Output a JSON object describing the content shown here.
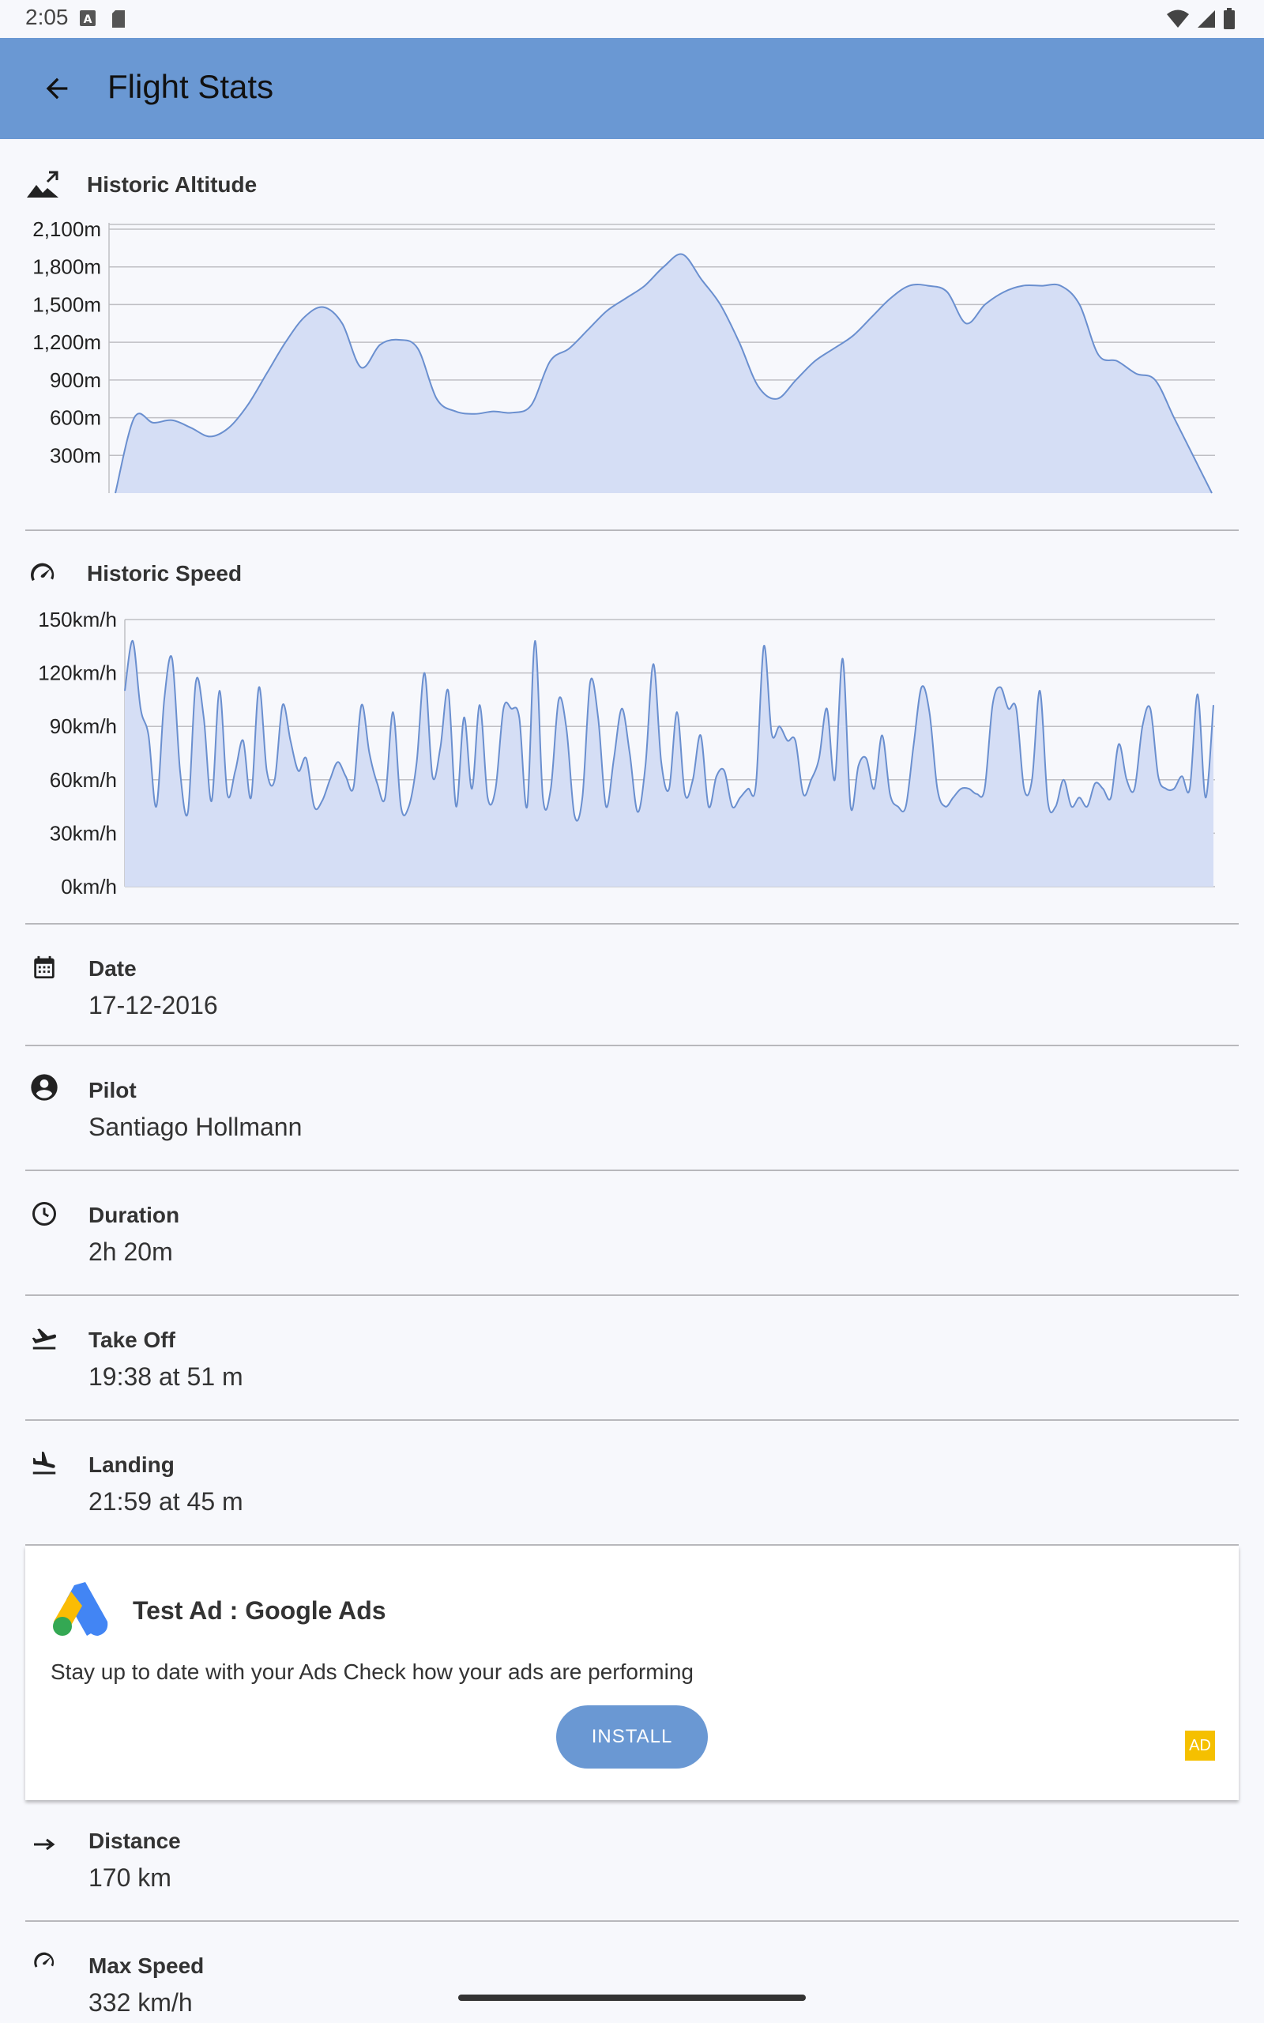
{
  "status_bar": {
    "time": "2:05",
    "icons": [
      "a-icon",
      "sd-card-icon",
      "wifi-icon",
      "signal-icon",
      "battery-icon"
    ]
  },
  "app_bar": {
    "title": "Flight Stats",
    "back_icon": "arrow-back-icon"
  },
  "altitude_section": {
    "title": "Historic Altitude",
    "icon": "terrain-up-icon",
    "chart_data": {
      "type": "area",
      "ylabels": [
        "2,100m",
        "1,800m",
        "1,500m",
        "1,200m",
        "900m",
        "600m",
        "300m"
      ],
      "ylim": [
        0,
        2100
      ],
      "y_unit": "m",
      "grid": true,
      "values": [
        0,
        600,
        560,
        580,
        520,
        450,
        520,
        700,
        950,
        1200,
        1400,
        1480,
        1350,
        1000,
        1180,
        1220,
        1150,
        750,
        650,
        630,
        650,
        640,
        700,
        1050,
        1150,
        1300,
        1450,
        1550,
        1650,
        1800,
        1900,
        1700,
        1500,
        1200,
        850,
        750,
        900,
        1050,
        1150,
        1250,
        1400,
        1550,
        1650,
        1650,
        1600,
        1350,
        1500,
        1600,
        1650,
        1650,
        1650,
        1500,
        1100,
        1050,
        950,
        900,
        600,
        300,
        0
      ]
    }
  },
  "speed_section": {
    "title": "Historic Speed",
    "icon": "speedometer-icon",
    "chart_data": {
      "type": "area",
      "ylabels": [
        "150km/h",
        "120km/h",
        "90km/h",
        "60km/h",
        "30km/h",
        "0km/h"
      ],
      "ylim": [
        0,
        150
      ],
      "y_unit": "km/h",
      "grid": true,
      "values": [
        110,
        138,
        100,
        85,
        45,
        105,
        128,
        65,
        42,
        115,
        95,
        48,
        110,
        52,
        65,
        82,
        50,
        112,
        65,
        60,
        102,
        82,
        65,
        72,
        45,
        48,
        60,
        70,
        62,
        56,
        102,
        75,
        58,
        50,
        98,
        45,
        45,
        70,
        120,
        62,
        78,
        110,
        45,
        95,
        55,
        102,
        50,
        55,
        100,
        100,
        95,
        45,
        138,
        50,
        55,
        105,
        88,
        40,
        50,
        115,
        95,
        45,
        72,
        100,
        75,
        42,
        68,
        125,
        70,
        55,
        98,
        52,
        60,
        85,
        45,
        62,
        65,
        45,
        50,
        55,
        57,
        135,
        86,
        90,
        82,
        82,
        52,
        60,
        72,
        100,
        60,
        128,
        45,
        68,
        72,
        55,
        85,
        52,
        45,
        45,
        80,
        112,
        98,
        55,
        45,
        50,
        55,
        55,
        52,
        55,
        102,
        112,
        100,
        100,
        55,
        60,
        110,
        48,
        45,
        60,
        45,
        50,
        45,
        58,
        55,
        50,
        80,
        60,
        55,
        90,
        100,
        62,
        55,
        55,
        62,
        55,
        108,
        50,
        102
      ]
    }
  },
  "details": [
    {
      "icon": "calendar-icon",
      "label": "Date",
      "value": "17-12-2016"
    },
    {
      "icon": "account-circle-icon",
      "label": "Pilot",
      "value": "Santiago Hollmann"
    },
    {
      "icon": "clock-icon",
      "label": "Duration",
      "value": "2h 20m"
    },
    {
      "icon": "flight-takeoff-icon",
      "label": "Take Off",
      "value": "19:38 at 51 m"
    },
    {
      "icon": "flight-land-icon",
      "label": "Landing",
      "value": "21:59 at 45 m"
    }
  ],
  "ad": {
    "title": "Test Ad : Google Ads",
    "body": "Stay up to date with your Ads Check how your ads are performing",
    "button": "INSTALL",
    "badge": "AD",
    "logo_icon": "google-ads-logo-icon"
  },
  "more_details": [
    {
      "icon": "arrow-right-icon",
      "label": "Distance",
      "value": "170 km"
    },
    {
      "icon": "speedometer-icon",
      "label": "Max Speed",
      "value": "332 km/h"
    }
  ],
  "colors": {
    "app_bar": "#6a98d3",
    "chart_line": "#6a8fcf",
    "chart_fill": "#d5def5",
    "background": "#f7f8fc",
    "ad_badge": "#f5c000"
  }
}
